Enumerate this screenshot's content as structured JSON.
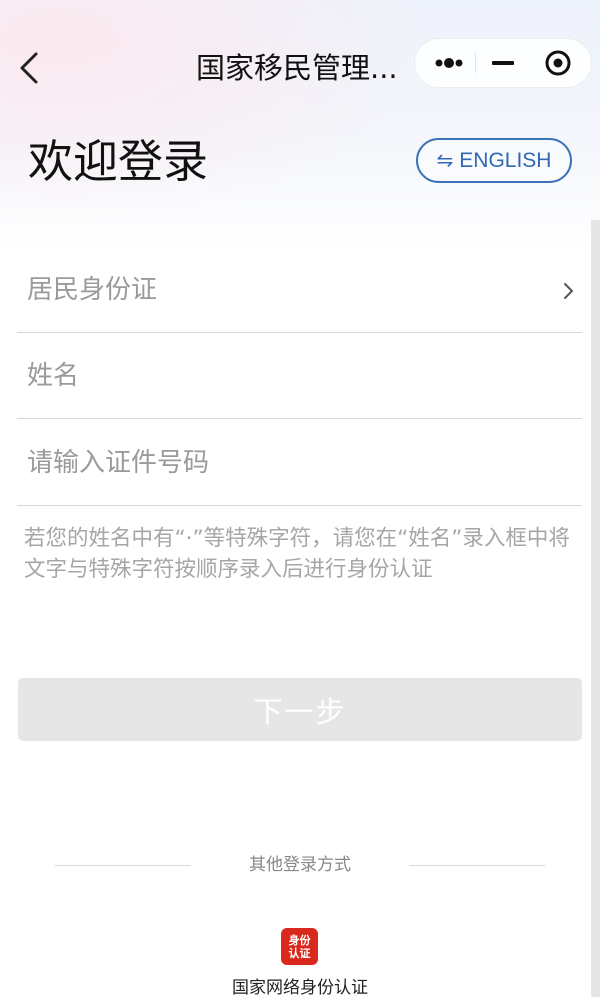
{
  "nav": {
    "title": "国家移民管理...",
    "back_icon": "chevron-left-icon",
    "more_icon": "more-dots-icon",
    "minimize_icon": "minimize-icon",
    "close_icon": "target-circle-icon"
  },
  "header": {
    "title": "欢迎登录",
    "language_button": "ENGLISH",
    "language_icon": "swap-arrows-icon",
    "language_icon_glyph": "⇋"
  },
  "form": {
    "id_type": "居民身份证",
    "name_placeholder": "姓名",
    "id_number_placeholder": "请输入证件号码",
    "hint": "若您的姓名中有“·”等特殊字符，请您在“姓名”录入框中将文字与特殊字符按顺序录入后进行身份认证",
    "next_button": "下一步"
  },
  "other_login": {
    "label": "其他登录方式",
    "idauth_logo_line1": "身份",
    "idauth_logo_line2": "认证",
    "idauth_label": "国家网络身份认证"
  },
  "colors": {
    "accent_blue": "#2f69b4",
    "disabled_button": "#e6e6e6",
    "logo_red": "#d9291c",
    "placeholder_gray": "#9a9a9a"
  }
}
